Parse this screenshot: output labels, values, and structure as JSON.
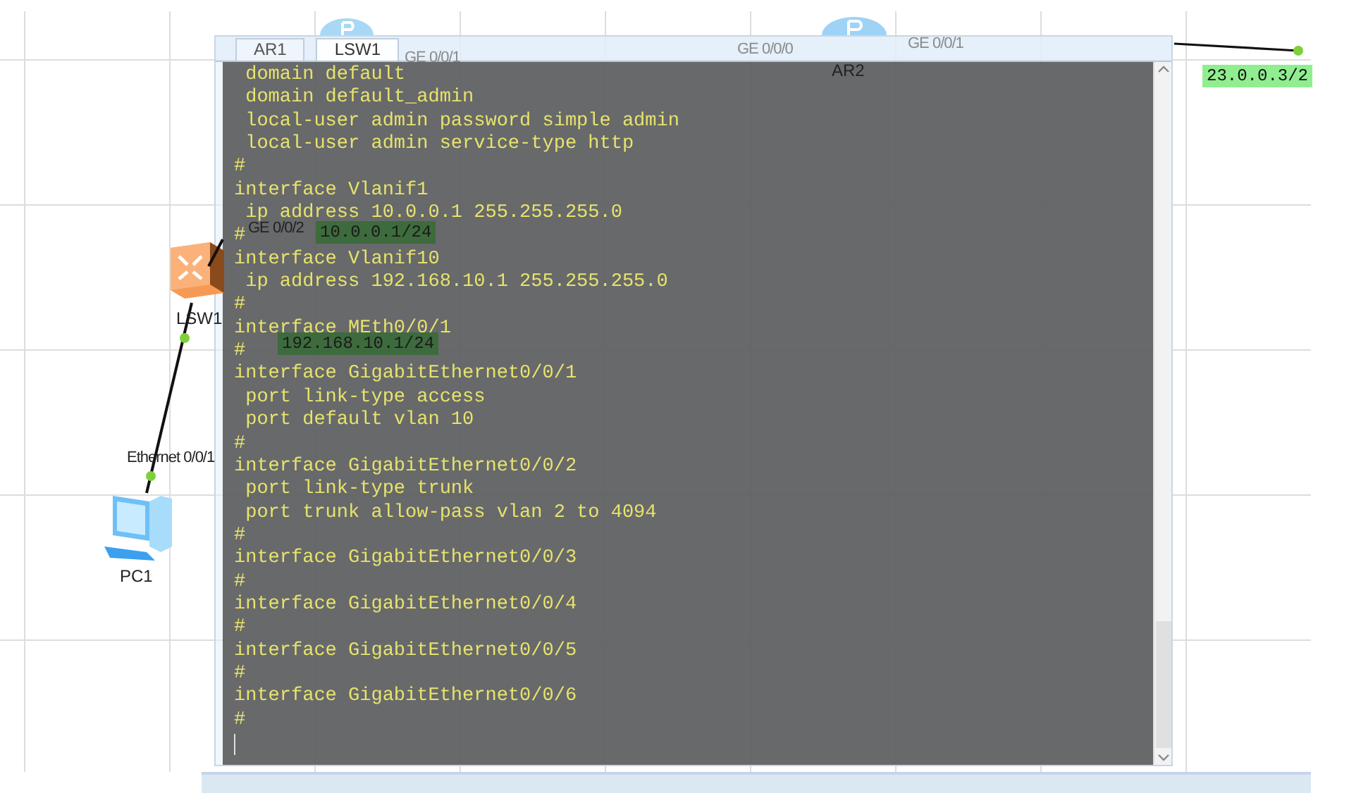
{
  "canvas": {
    "labels": [
      {
        "kind": "port",
        "text": "GE 0/0/1",
        "behind_window": true
      },
      {
        "kind": "port",
        "text": "GE 0/0/2",
        "behind_window": false
      },
      {
        "kind": "ip",
        "text": "10.0.0.1/24",
        "behind_window": true
      },
      {
        "kind": "node",
        "text": "LSW1"
      },
      {
        "kind": "ip",
        "text": "192.168.10.1/24",
        "behind_window": true
      },
      {
        "kind": "port",
        "text": "Ethernet 0/0/1",
        "behind_window": false
      },
      {
        "kind": "node",
        "text": "PC1"
      },
      {
        "kind": "port",
        "text": "GE 0/0/0",
        "behind_window": true
      },
      {
        "kind": "node",
        "text": "AR2"
      },
      {
        "kind": "port",
        "text": "GE 0/0/1",
        "behind_window": true
      },
      {
        "kind": "ip",
        "text": "23.0.0.3/2",
        "behind_window": false
      }
    ]
  },
  "cli_window": {
    "tabs": [
      {
        "label": "AR1",
        "selected": false
      },
      {
        "label": "LSW1",
        "selected": true
      }
    ],
    "lines": [
      " domain default",
      " domain default_admin",
      " local-user admin password simple admin",
      " local-user admin service-type http",
      "#",
      "interface Vlanif1",
      " ip address 10.0.0.1 255.255.255.0",
      "#",
      "interface Vlanif10",
      " ip address 192.168.10.1 255.255.255.0",
      "#",
      "interface MEth0/0/1",
      "#",
      "interface GigabitEthernet0/0/1",
      " port link-type access",
      " port default vlan 10",
      "#",
      "interface GigabitEthernet0/0/2",
      " port link-type trunk",
      " port trunk allow-pass vlan 2 to 4094",
      "#",
      "interface GigabitEthernet0/0/3",
      "#",
      "interface GigabitEthernet0/0/4",
      "#",
      "interface GigabitEthernet0/0/5",
      "#",
      "interface GigabitEthernet0/0/6",
      "#"
    ]
  }
}
